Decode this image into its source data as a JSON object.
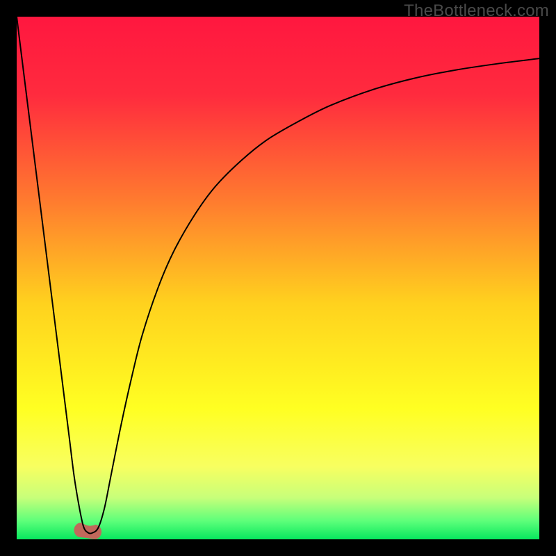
{
  "watermark": "TheBottleneck.com",
  "chart_data": {
    "type": "line",
    "title": "",
    "xlabel": "",
    "ylabel": "",
    "xlim": [
      0,
      100
    ],
    "ylim": [
      0,
      100
    ],
    "background_gradient": {
      "stops": [
        {
          "offset": 0.0,
          "color": "#ff173f"
        },
        {
          "offset": 0.15,
          "color": "#ff2b3e"
        },
        {
          "offset": 0.35,
          "color": "#ff7a2f"
        },
        {
          "offset": 0.55,
          "color": "#ffd21e"
        },
        {
          "offset": 0.75,
          "color": "#ffff22"
        },
        {
          "offset": 0.86,
          "color": "#f8ff60"
        },
        {
          "offset": 0.92,
          "color": "#c8ff7a"
        },
        {
          "offset": 0.965,
          "color": "#5dff7a"
        },
        {
          "offset": 1.0,
          "color": "#07e85e"
        }
      ]
    },
    "series": [
      {
        "name": "bottleneck-curve",
        "color": "#000000",
        "width": 2.0,
        "x": [
          0.0,
          2.0,
          4.0,
          6.0,
          8.0,
          10.0,
          11.0,
          12.0,
          12.8,
          13.6,
          14.4,
          15.6,
          16.8,
          18.0,
          20.0,
          22.0,
          24.0,
          27.0,
          30.0,
          34.0,
          38.0,
          43.0,
          48.0,
          54.0,
          60.0,
          68.0,
          76.0,
          84.0,
          92.0,
          100.0
        ],
        "y": [
          100.0,
          84.0,
          68.0,
          52.0,
          36.0,
          20.0,
          12.0,
          6.0,
          2.4,
          1.3,
          1.2,
          2.2,
          6.0,
          12.0,
          22.0,
          31.0,
          39.0,
          48.0,
          55.0,
          62.0,
          67.5,
          72.5,
          76.5,
          80.0,
          83.0,
          86.0,
          88.2,
          89.8,
          91.0,
          92.0
        ]
      }
    ],
    "blob": {
      "color": "#c1685b",
      "cx": 13.6,
      "cy": 1.6,
      "rx": 2.4,
      "ry": 1.4,
      "tilt_deg": 8
    }
  }
}
